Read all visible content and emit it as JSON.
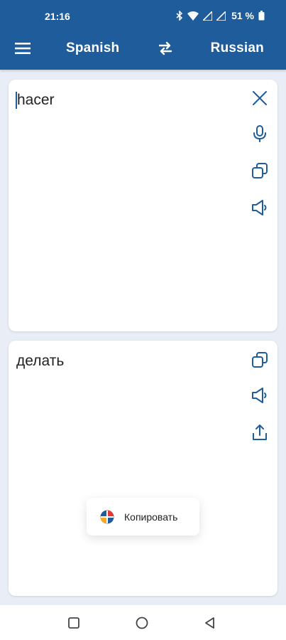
{
  "status_bar": {
    "time": "21:16",
    "battery": "51 %"
  },
  "app_bar": {
    "menu_icon": "menu-icon",
    "source_language": "Spanish",
    "target_language": "Russian",
    "swap_icon": "swap-icon"
  },
  "input_card": {
    "text": "hacer",
    "actions": [
      "clear-icon",
      "microphone-icon",
      "copy-icon",
      "speaker-icon"
    ]
  },
  "output_card": {
    "text": "делать",
    "actions": [
      "copy-icon",
      "speaker-icon",
      "share-icon"
    ]
  },
  "toast": {
    "label": "Копировать"
  },
  "nav_bar": {
    "buttons": [
      "recents-icon",
      "home-icon",
      "back-icon"
    ]
  },
  "colors": {
    "primary": "#1e5c9b",
    "background": "#e9eef6"
  }
}
